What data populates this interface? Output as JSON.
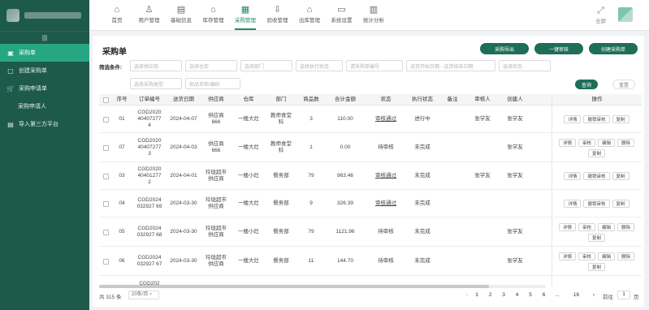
{
  "sidebar": {
    "items": [
      {
        "icon": "list-icon",
        "label": "采购单",
        "active": true
      },
      {
        "icon": "file-icon",
        "label": "创建采购单",
        "active": false
      },
      {
        "icon": "cart-icon",
        "label": "采购申请单",
        "active": false
      },
      {
        "icon": "",
        "label": "采购申请人",
        "active": false
      },
      {
        "icon": "store-icon",
        "label": "导入第三方平台",
        "active": false
      }
    ]
  },
  "topnav": {
    "items": [
      {
        "icon": "home-icon",
        "glyph": "⌂",
        "label": "首页"
      },
      {
        "icon": "users-icon",
        "glyph": "♙",
        "label": "用户管理"
      },
      {
        "icon": "info-icon",
        "glyph": "▤",
        "label": "基础信息"
      },
      {
        "icon": "warehouse-icon",
        "glyph": "⌂",
        "label": "库存管理"
      },
      {
        "icon": "purchase-icon",
        "glyph": "▦",
        "label": "采购管理"
      },
      {
        "icon": "inbound-icon",
        "glyph": "⇩",
        "label": "验收管理"
      },
      {
        "icon": "outbound-icon",
        "glyph": "⌂",
        "label": "出库管理"
      },
      {
        "icon": "settings-icon",
        "glyph": "▭",
        "label": "系统设置"
      },
      {
        "icon": "stats-icon",
        "glyph": "▥",
        "label": "统计分析"
      }
    ],
    "active_index": 4,
    "fullscreen_label": "全屏"
  },
  "page": {
    "title": "采购单",
    "buttons": {
      "export": "采购导出",
      "one_click": "一键审核",
      "create": "创建采购单"
    },
    "filter_label": "筛选条件:",
    "filters": [
      "选择供应商",
      "选择仓库",
      "选择部门",
      "选择执行状态",
      "请采购单编号",
      "送货开始日期 - 送货结束日期",
      "选择状态",
      "选择采购类型",
      "商品名称/编码"
    ],
    "search": "查询",
    "reset": "重置"
  },
  "table": {
    "headers": [
      "序号",
      "订单编号",
      "送货日期",
      "供应商",
      "仓库",
      "部门",
      "商品数",
      "合计金额",
      "状态",
      "执行状态",
      "备注",
      "审核人",
      "创建人",
      "操作"
    ],
    "rows": [
      {
        "seq": "01",
        "order_no": "CGD2020404072774",
        "date": "2024-04-07",
        "supplier": "供应商666",
        "warehouse": "一楼大灶",
        "dept": "教师食堂科",
        "qty": "3",
        "amount": "110.00",
        "status": "审核通过",
        "exec": "进行中",
        "note": "",
        "auditor": "张学友",
        "creator": "张学友",
        "ops": [
          "详情",
          "撤销审核",
          "复制"
        ]
      },
      {
        "seq": "07",
        "order_no": "CGD2020404072773",
        "date": "2024-04-03",
        "supplier": "供应商666",
        "warehouse": "一楼大灶",
        "dept": "教师食堂科",
        "qty": "1",
        "amount": "0.00",
        "status": "待审核",
        "exec": "未完成",
        "note": "",
        "auditor": "",
        "creator": "张学友",
        "ops": [
          "详情",
          "审核",
          "编辑",
          "删除",
          "复制"
        ]
      },
      {
        "seq": "03",
        "order_no": "CGD2020404012772",
        "date": "2024-04-01",
        "supplier": "玲珑超市供应商",
        "warehouse": "一楼小灶",
        "dept": "餐务部",
        "qty": "79",
        "amount": "963.46",
        "status": "审核通过",
        "exec": "未完成",
        "note": "",
        "auditor": "张学友",
        "creator": "张学友",
        "ops": [
          "详情",
          "撤销审核",
          "复制"
        ]
      },
      {
        "seq": "04",
        "order_no": "CGD2024032927 69",
        "date": "2024-03-30",
        "supplier": "玲珑超市供应商",
        "warehouse": "一楼大灶",
        "dept": "餐务部",
        "qty": "9",
        "amount": "326.39",
        "status": "审核通过",
        "exec": "未完成",
        "note": "",
        "auditor": "",
        "creator": "",
        "ops": [
          "详情",
          "撤销审核",
          "复制"
        ]
      },
      {
        "seq": "05",
        "order_no": "CGD2024032927 68",
        "date": "2024-03-30",
        "supplier": "玲珑超市供应商",
        "warehouse": "一楼小灶",
        "dept": "餐务部",
        "qty": "79",
        "amount": "1121.96",
        "status": "待审核",
        "exec": "未完成",
        "note": "",
        "auditor": "",
        "creator": "张学友",
        "ops": [
          "详情",
          "审核",
          "编辑",
          "删除",
          "复制"
        ]
      },
      {
        "seq": "06",
        "order_no": "CGD2024032927 67",
        "date": "2024-03-30",
        "supplier": "玲珑超市供应商",
        "warehouse": "一楼大灶",
        "dept": "餐务部",
        "qty": "11",
        "amount": "144.70",
        "status": "待审核",
        "exec": "未完成",
        "note": "",
        "auditor": "",
        "creator": "张学友",
        "ops": [
          "详情",
          "审核",
          "编辑",
          "删除",
          "复制"
        ]
      },
      {
        "seq": "",
        "order_no": "CGD202",
        "date": "",
        "supplier": "",
        "warehouse": "",
        "dept": "",
        "qty": "",
        "amount": "",
        "status": "",
        "exec": "",
        "note": "",
        "auditor": "",
        "creator": "",
        "ops": []
      }
    ]
  },
  "pagination": {
    "total": "共 315 条",
    "page_size": "20条/页",
    "pages": [
      "1",
      "2",
      "3",
      "4",
      "5",
      "6",
      "...",
      "16"
    ],
    "current": "1",
    "goto_label": "前往",
    "goto_value": "1",
    "page_suffix": "页"
  },
  "colors": {
    "sidebar_bg": "#1e5a49",
    "sidebar_active": "#26a682",
    "primary": "#1e6e58"
  }
}
